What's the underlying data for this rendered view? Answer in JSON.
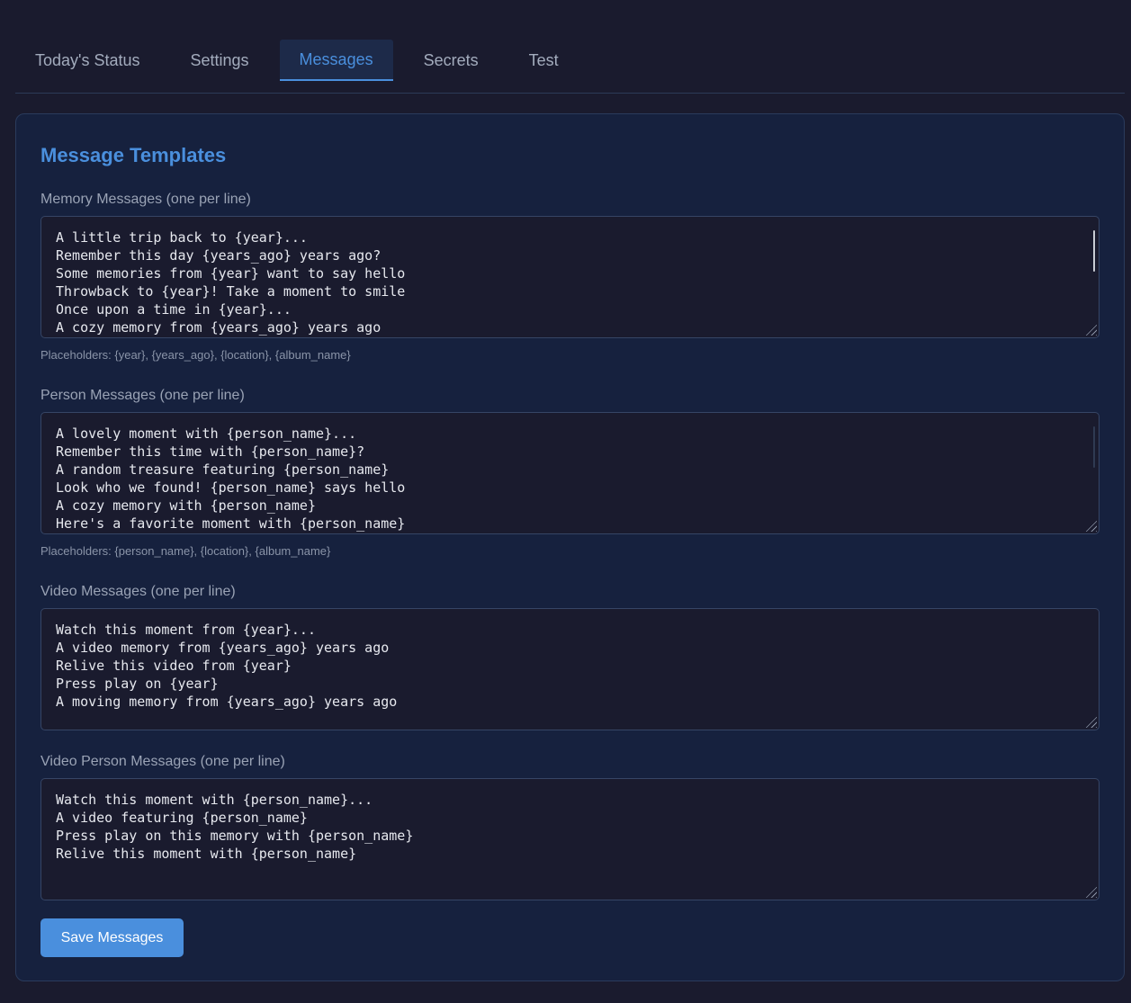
{
  "tabs": [
    {
      "label": "Today's Status",
      "active": false
    },
    {
      "label": "Settings",
      "active": false
    },
    {
      "label": "Messages",
      "active": true
    },
    {
      "label": "Secrets",
      "active": false
    },
    {
      "label": "Test",
      "active": false
    }
  ],
  "panel": {
    "title": "Message Templates",
    "save_label": "Save Messages"
  },
  "memory": {
    "label": "Memory Messages (one per line)",
    "value": "A little trip back to {year}...\nRemember this day {years_ago} years ago?\nSome memories from {year} want to say hello\nThrowback to {year}! Take a moment to smile\nOnce upon a time in {year}...\nA cozy memory from {years_ago} years ago",
    "hint": "Placeholders: {year}, {years_ago}, {location}, {album_name}"
  },
  "person": {
    "label": "Person Messages (one per line)",
    "value": "A lovely moment with {person_name}...\nRemember this time with {person_name}?\nA random treasure featuring {person_name}\nLook who we found! {person_name} says hello\nA cozy memory with {person_name}\nHere's a favorite moment with {person_name}",
    "hint": "Placeholders: {person_name}, {location}, {album_name}"
  },
  "video": {
    "label": "Video Messages (one per line)",
    "value": "Watch this moment from {year}...\nA video memory from {years_ago} years ago\nRelive this video from {year}\nPress play on {year}\nA moving memory from {years_ago} years ago"
  },
  "video_person": {
    "label": "Video Person Messages (one per line)",
    "value": "Watch this moment with {person_name}...\nA video featuring {person_name}\nPress play on this memory with {person_name}\nRelive this moment with {person_name}"
  }
}
